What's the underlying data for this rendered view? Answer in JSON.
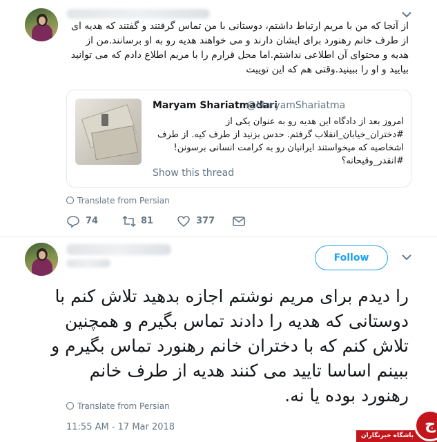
{
  "tweet1": {
    "text": "از آنجا که من با مریم ارتباط داشتم، دوستانی با من تماس گرفتند و گفتند که هدیه ای از طرف خانم رهنورد برای ایشان دارند و می خواهند هدیه رو به او برسانند.من از هدیه و محتوای آن اطلاعی نداشتم.اما محل قرارم را با مریم اطلاع دادم که می توانید بیایید و او را ببینید.وقتی هم که این توییت",
    "quoted": {
      "name": "Maryam Shariatmadari",
      "handle": "@MaryamShariatma",
      "text": "امروز بعد از دادگاه این هدیه رو به عنوان یکی از #دختران_خیابان_انقلاب گرفتم. حدس بزنید از طرف کیه. از طرف اشخاصیه که میخواستند ایرانیان رو به کرامت انسانی برسونن! #انقدر_وقیحانه؟",
      "show_thread": "Show this thread"
    },
    "translate": "Translate from Persian",
    "actions": {
      "replies": "74",
      "retweets": "81",
      "likes": "377"
    }
  },
  "tweet2": {
    "follow_label": "Follow",
    "text": "را دیدم برای مریم نوشتم اجازه بدهید تلاش کنم با دوستانی که هدیه را دادند تماس بگیرم و همچنین تلاش کنم که با دختران خانم رهنورد تماس بگیرم و ببینم اساسا تایید می کنند هدیه از طرف خانم رهنورد بوده یا نه.",
    "translate": "Translate from Persian",
    "timestamp": "11:55 AM - 17 Mar 2018"
  },
  "watermark": {
    "label": "باشگاه خبرنگاران",
    "glyph": "ج"
  },
  "colors": {
    "accent": "#1da1f2",
    "muted": "#657786",
    "badge": "#c3161c"
  },
  "icons": [
    "chevron-down-icon",
    "globe-icon",
    "reply-icon",
    "retweet-icon",
    "like-icon",
    "dm-icon"
  ]
}
